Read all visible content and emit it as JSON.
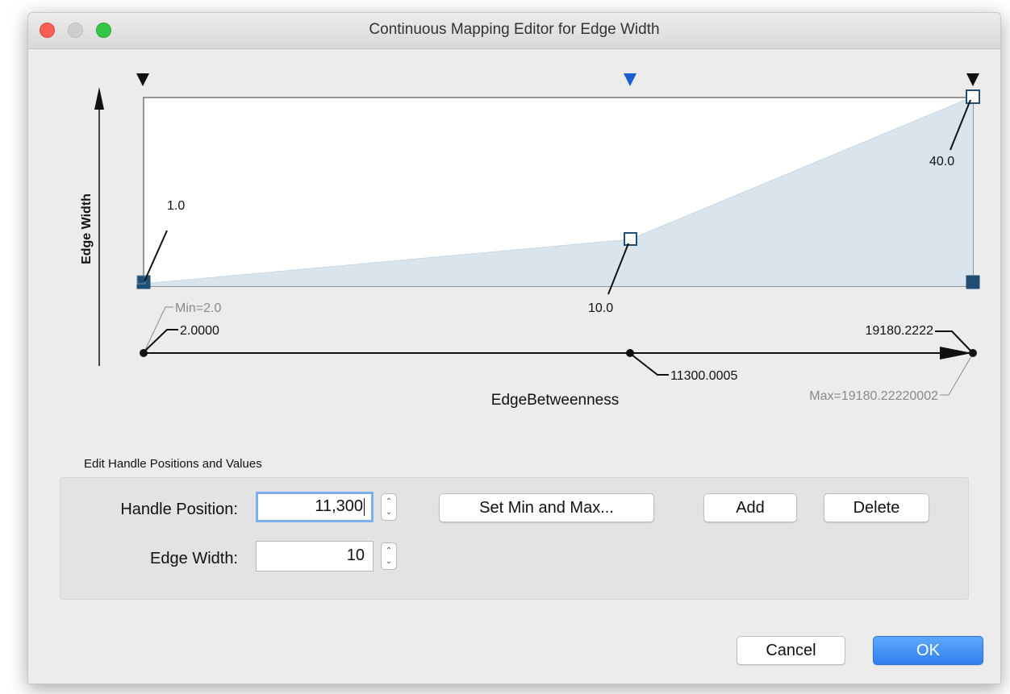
{
  "window": {
    "title": "Continuous Mapping Editor for Edge Width"
  },
  "graph": {
    "y_axis_label": "Edge Width",
    "x_axis_label": "EdgeBetweenness",
    "min_label": "Min=2.0",
    "max_label": "Max=19180.22220002",
    "points": [
      {
        "position": 2.0,
        "value": 1.0,
        "value_label": "1.0",
        "position_label": "2.0000"
      },
      {
        "position": 11300.0005,
        "value": 10.0,
        "value_label": "10.0",
        "position_label": "11300.0005"
      },
      {
        "position": 19180.2222,
        "value": 40.0,
        "value_label": "40.0",
        "position_label": "19180.2222"
      }
    ],
    "fill_color": "#d9e4ec",
    "handle_color": "#1f4f75",
    "selected_marker_color": "#1a5fd1"
  },
  "editor": {
    "section_title": "Edit Handle Positions and Values",
    "handle_position_label": "Handle Position:",
    "handle_position_value": "11,300",
    "edge_width_label": "Edge Width:",
    "edge_width_value": "10",
    "set_min_max_label": "Set Min and Max...",
    "add_label": "Add",
    "delete_label": "Delete"
  },
  "footer": {
    "cancel_label": "Cancel",
    "ok_label": "OK"
  }
}
